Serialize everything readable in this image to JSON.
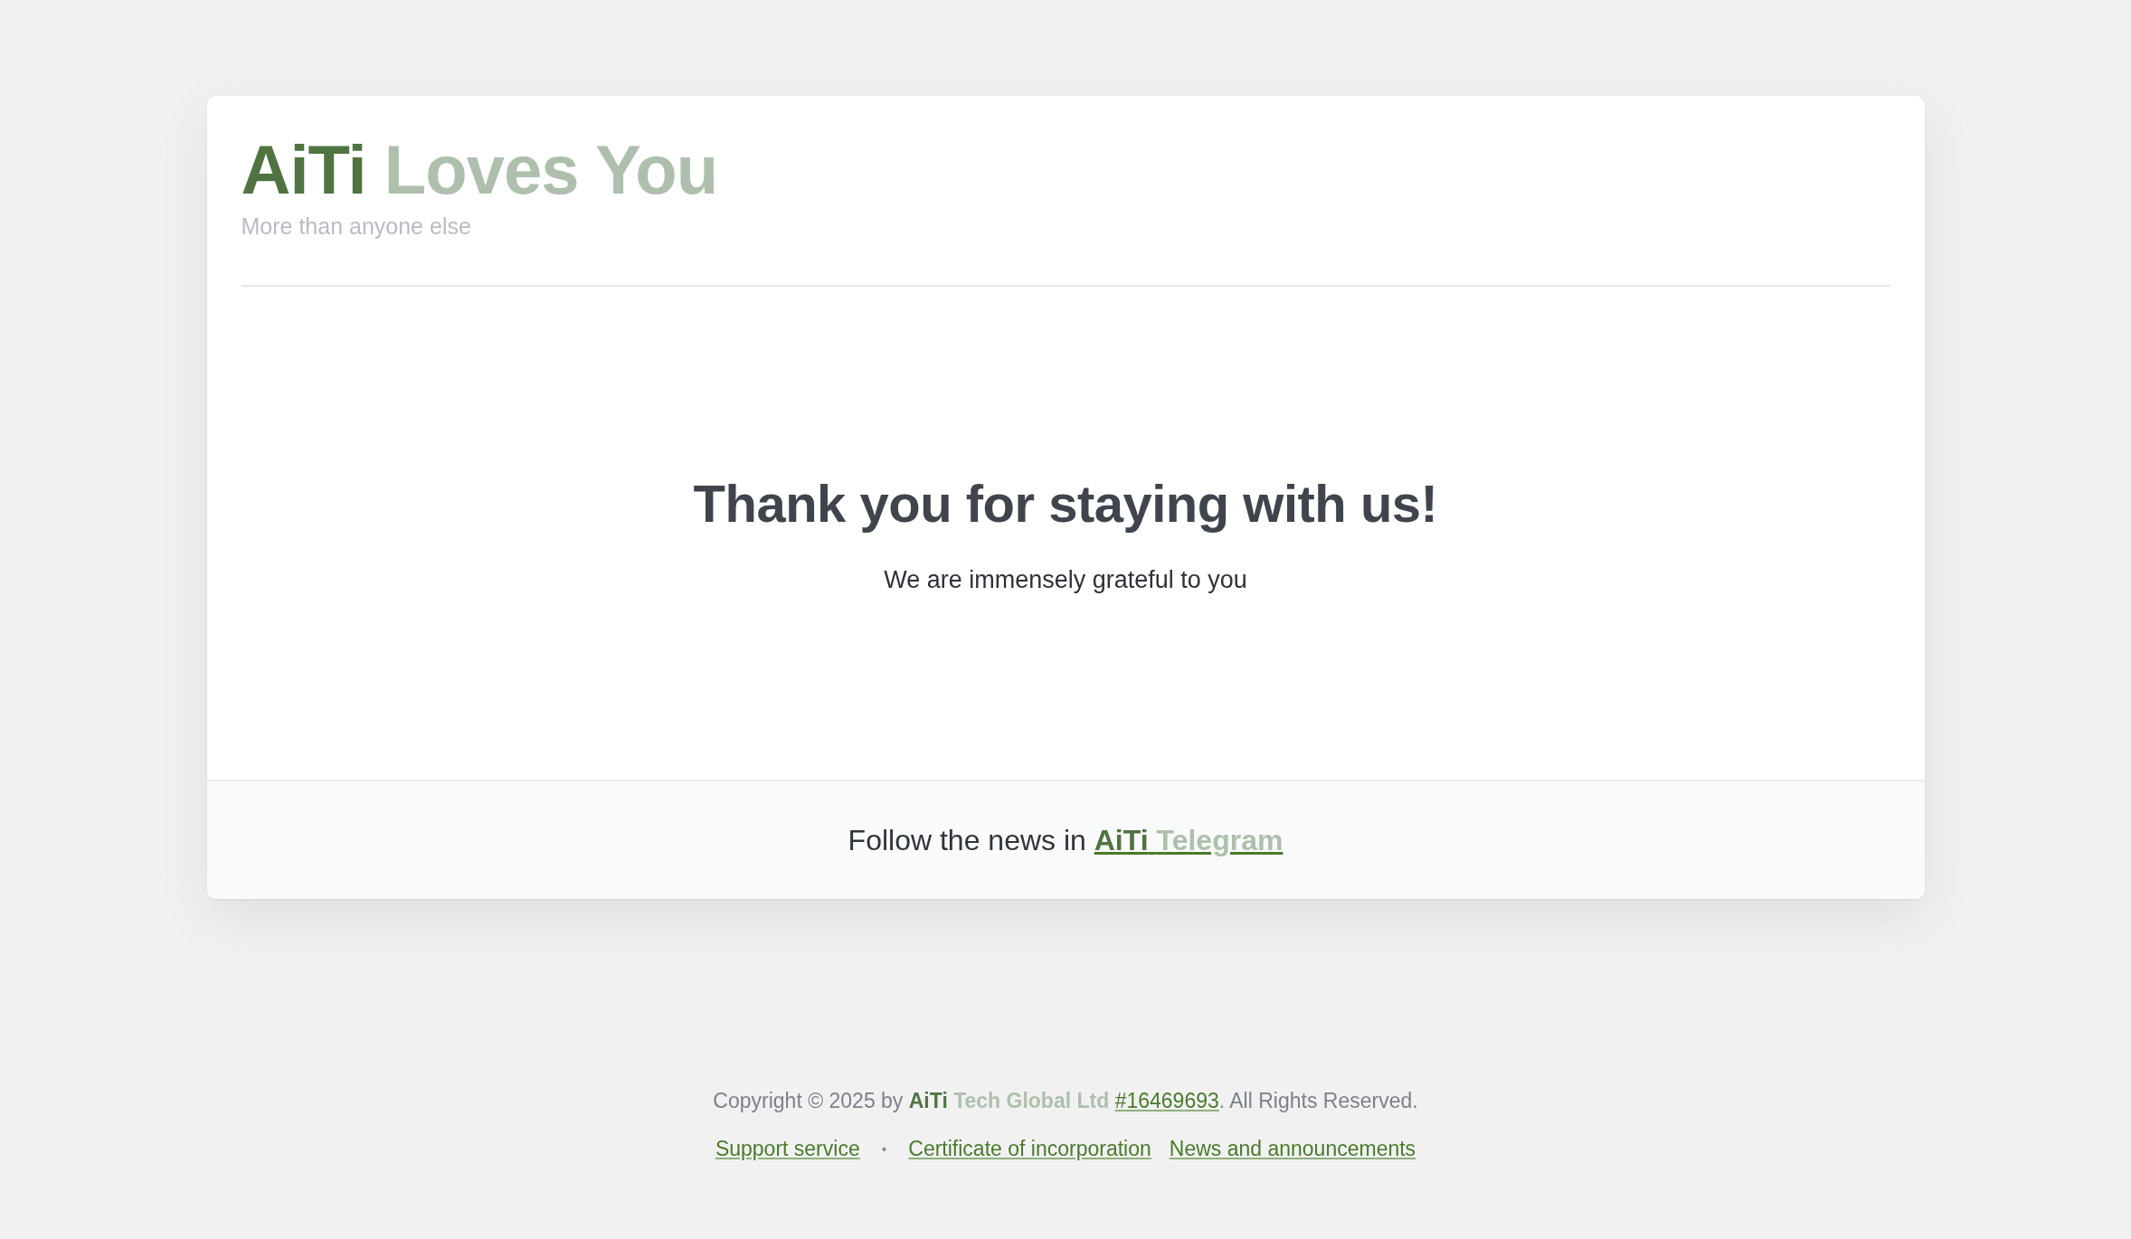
{
  "header": {
    "brand": "AiTi",
    "title_rest": "Loves You",
    "tagline": "More than anyone else"
  },
  "message": {
    "heading": "Thank you for staying with us!",
    "text": "We are immensely grateful to you"
  },
  "card_footer": {
    "text": "Follow the news in",
    "link_brand": "AiTi",
    "link_rest": "Telegram"
  },
  "copyright": {
    "prefix": "Copyright © 2025 by",
    "brand": "AiTi",
    "company": "Tech Global Ltd",
    "number_link": "#16469693",
    "suffix": ". All Rights Reserved."
  },
  "footer_links": [
    {
      "kind": "link",
      "label": "Support service"
    },
    {
      "kind": "separator",
      "label": "•"
    },
    {
      "kind": "link",
      "label": "Certificate of incorporation"
    },
    {
      "kind": "link",
      "label": "News and announcements"
    }
  ]
}
